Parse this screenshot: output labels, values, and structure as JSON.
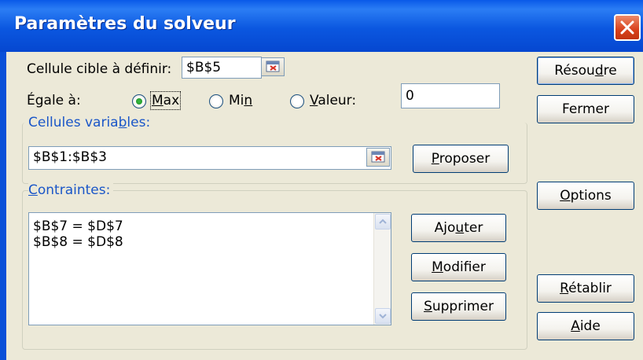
{
  "window": {
    "title": "Paramètres du solveur"
  },
  "target_cell": {
    "label": "Cellule cible à définir:",
    "value": "$B$5"
  },
  "equal_to": {
    "label": "Égale à:",
    "options": [
      {
        "pre": "",
        "mn": "M",
        "post": "ax",
        "selected": true
      },
      {
        "pre": "Mi",
        "mn": "n",
        "post": "",
        "selected": false
      },
      {
        "pre": "",
        "mn": "V",
        "post": "aleur:",
        "selected": false
      }
    ],
    "value": "0"
  },
  "variable_cells": {
    "pre": "Cellules varia",
    "mn": "b",
    "post": "les:",
    "value": "$B$1:$B$3"
  },
  "constraints": {
    "pre": "",
    "mn": "C",
    "post": "ontraintes:",
    "items": [
      "$B$7 = $D$7",
      "$B$8 = $D$8"
    ]
  },
  "buttons": {
    "solve": {
      "pre": "Résou",
      "mn": "d",
      "post": "re"
    },
    "close": {
      "pre": "Fermer",
      "mn": "",
      "post": ""
    },
    "options": {
      "pre": "",
      "mn": "O",
      "post": "ptions"
    },
    "reset": {
      "pre": "",
      "mn": "R",
      "post": "établir"
    },
    "help": {
      "pre": "",
      "mn": "A",
      "post": "ide"
    },
    "guess": {
      "pre": "",
      "mn": "P",
      "post": "roposer"
    },
    "add": {
      "pre": "Ajo",
      "mn": "u",
      "post": "ter"
    },
    "modify": {
      "pre": "",
      "mn": "M",
      "post": "odifier"
    },
    "delete": {
      "pre": "",
      "mn": "S",
      "post": "upprimer"
    }
  },
  "icons": {
    "close": "close-x-icon",
    "picker": "collapse-dialog-icon",
    "scroll_up": "chevron-up-icon",
    "scroll_down": "chevron-down-icon"
  },
  "colors": {
    "titlebar": "#0a5ae8",
    "dialog_bg": "#ece9d8",
    "close": "#d9411c",
    "radio_dot": "#2aa832",
    "group_label": "#1a56c8"
  }
}
